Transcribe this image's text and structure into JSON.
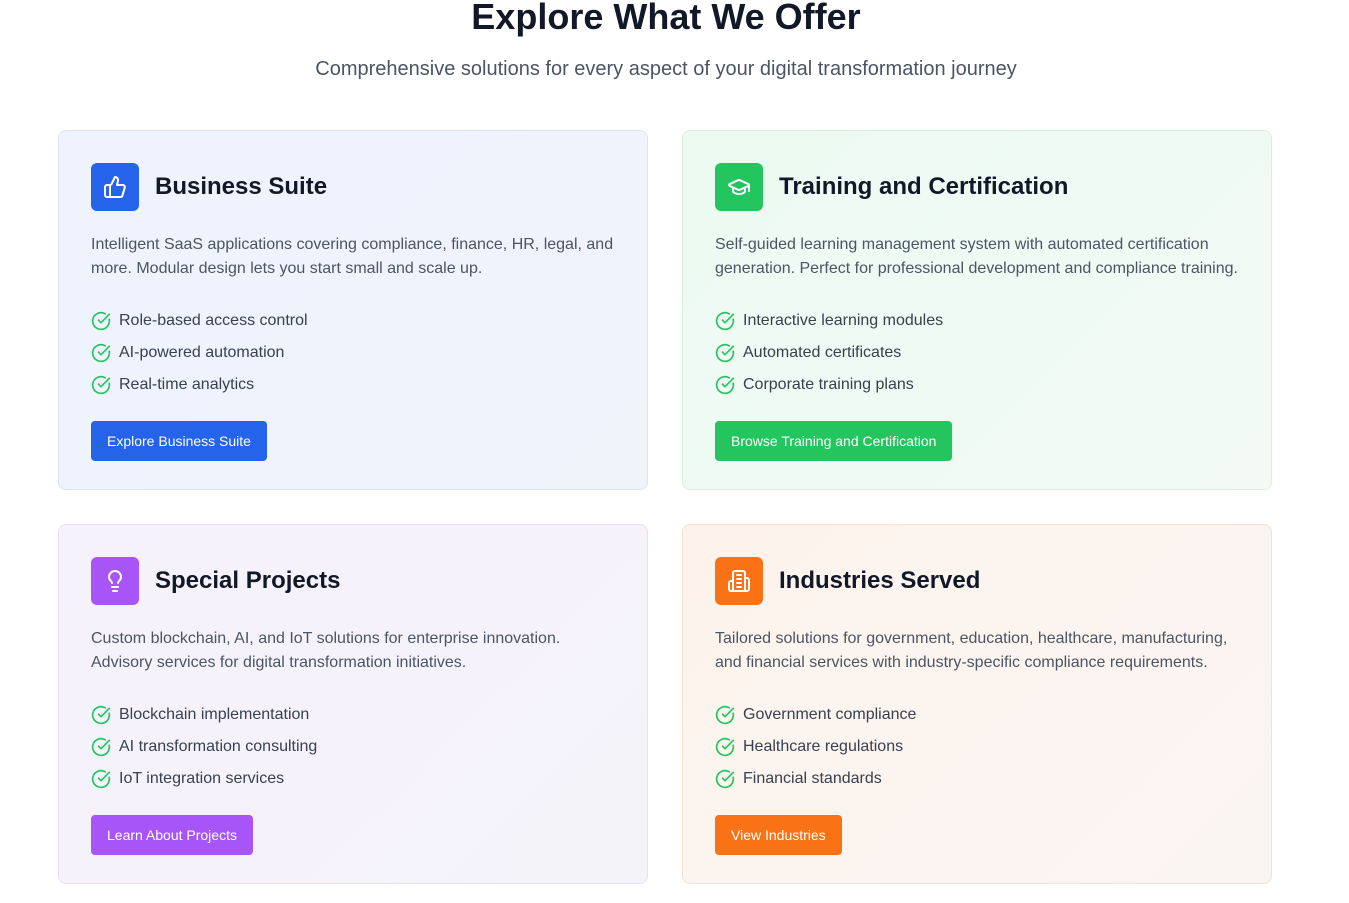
{
  "header": {
    "title": "Explore What We Offer",
    "subtitle": "Comprehensive solutions for every aspect of your digital transformation journey"
  },
  "cards": [
    {
      "icon": "thumbs-up-icon",
      "accent": "#2563eb",
      "title": "Business Suite",
      "description": "Intelligent SaaS applications covering compliance, finance, HR, legal, and more. Modular design lets you start small and scale up.",
      "features": [
        "Role-based access control",
        "AI-powered automation",
        "Real-time analytics"
      ],
      "button": "Explore Business Suite"
    },
    {
      "icon": "graduation-cap-icon",
      "accent": "#22c55e",
      "title": "Training and Certification",
      "description": "Self-guided learning management system with automated certification generation. Perfect for professional development and compliance training.",
      "features": [
        "Interactive learning modules",
        "Automated certificates",
        "Corporate training plans"
      ],
      "button": "Browse Training and Certification"
    },
    {
      "icon": "lightbulb-icon",
      "accent": "#a855f7",
      "title": "Special Projects",
      "description": "Custom blockchain, AI, and IoT solutions for enterprise innovation. Advisory services for digital transformation initiatives.",
      "features": [
        "Blockchain implementation",
        "AI transformation consulting",
        "IoT integration services"
      ],
      "button": "Learn About Projects"
    },
    {
      "icon": "building-icon",
      "accent": "#f97316",
      "title": "Industries Served",
      "description": "Tailored solutions for government, education, healthcare, manufacturing, and financial services with industry-specific compliance requirements.",
      "features": [
        "Government compliance",
        "Healthcare regulations",
        "Financial standards"
      ],
      "button": "View Industries"
    }
  ],
  "check_color": "#22c55e"
}
